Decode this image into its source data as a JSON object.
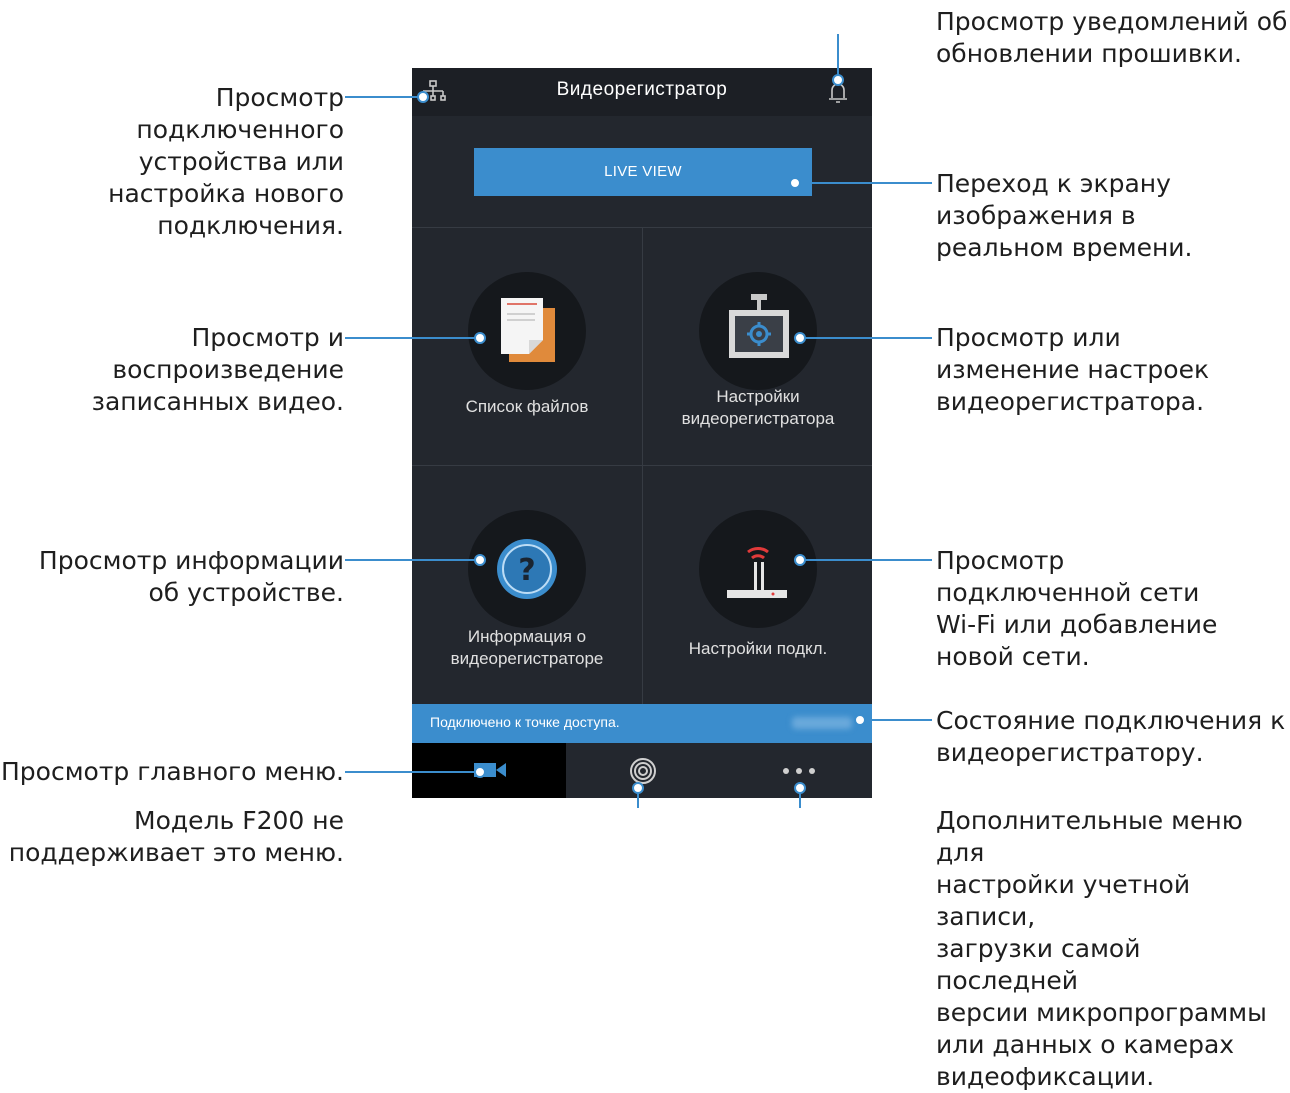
{
  "app": {
    "title": "Видеорегистратор",
    "live_view": "LIVE VIEW",
    "tiles": [
      {
        "label": "Список файлов"
      },
      {
        "label": "Настройки\nвидеорегистратора"
      },
      {
        "label": "Информация о\nвидеорегистраторе"
      },
      {
        "label": "Настройки подкл."
      }
    ],
    "status_text": "Подключено к точке доступа.",
    "colors": {
      "accent": "#3b8dcd",
      "background": "#22262d",
      "wifi_red": "#e23a3a"
    }
  },
  "annotations": {
    "network": "Просмотр\nподключенного\nустройства или\nнастройка нового\nподключения.",
    "firmware": "Просмотр уведомлений об\nобновлении прошивки.",
    "liveview": "Переход к экрану\nизображения в\nреальном времени.",
    "files": "Просмотр и\nвоспроизведение\nзаписанных видео.",
    "settings": "Просмотр или\nизменение настроек\nвидеорегистратора.",
    "info": "Просмотр информации\nоб устройстве.",
    "wifi": "Просмотр\nподключенной сети\nWi-Fi или добавление\nновой сети.",
    "status": "Состояние подключения к\nвидеорегистратору.",
    "main_menu": "Просмотр главного меню.",
    "f200": "Модель F200 не\nподдерживает это меню.",
    "more": "Дополнительные меню для\nнастройки учетной записи,\nзагрузки самой последней\nверсии микропрограммы\nили данных о камерах\nвидеофиксации."
  }
}
